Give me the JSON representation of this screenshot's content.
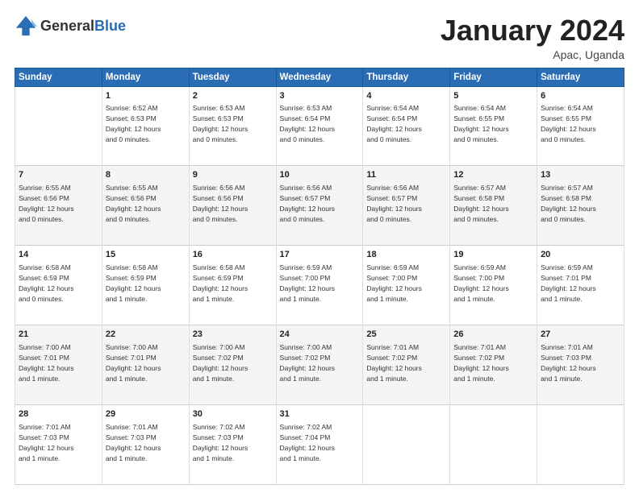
{
  "header": {
    "logo_general": "General",
    "logo_blue": "Blue",
    "title": "January 2024",
    "location": "Apac, Uganda"
  },
  "weekdays": [
    "Sunday",
    "Monday",
    "Tuesday",
    "Wednesday",
    "Thursday",
    "Friday",
    "Saturday"
  ],
  "weeks": [
    [
      {
        "day": "",
        "info": ""
      },
      {
        "day": "1",
        "info": "Sunrise: 6:52 AM\nSunset: 6:53 PM\nDaylight: 12 hours\nand 0 minutes."
      },
      {
        "day": "2",
        "info": "Sunrise: 6:53 AM\nSunset: 6:53 PM\nDaylight: 12 hours\nand 0 minutes."
      },
      {
        "day": "3",
        "info": "Sunrise: 6:53 AM\nSunset: 6:54 PM\nDaylight: 12 hours\nand 0 minutes."
      },
      {
        "day": "4",
        "info": "Sunrise: 6:54 AM\nSunset: 6:54 PM\nDaylight: 12 hours\nand 0 minutes."
      },
      {
        "day": "5",
        "info": "Sunrise: 6:54 AM\nSunset: 6:55 PM\nDaylight: 12 hours\nand 0 minutes."
      },
      {
        "day": "6",
        "info": "Sunrise: 6:54 AM\nSunset: 6:55 PM\nDaylight: 12 hours\nand 0 minutes."
      }
    ],
    [
      {
        "day": "7",
        "info": "Sunrise: 6:55 AM\nSunset: 6:56 PM\nDaylight: 12 hours\nand 0 minutes."
      },
      {
        "day": "8",
        "info": "Sunrise: 6:55 AM\nSunset: 6:56 PM\nDaylight: 12 hours\nand 0 minutes."
      },
      {
        "day": "9",
        "info": "Sunrise: 6:56 AM\nSunset: 6:56 PM\nDaylight: 12 hours\nand 0 minutes."
      },
      {
        "day": "10",
        "info": "Sunrise: 6:56 AM\nSunset: 6:57 PM\nDaylight: 12 hours\nand 0 minutes."
      },
      {
        "day": "11",
        "info": "Sunrise: 6:56 AM\nSunset: 6:57 PM\nDaylight: 12 hours\nand 0 minutes."
      },
      {
        "day": "12",
        "info": "Sunrise: 6:57 AM\nSunset: 6:58 PM\nDaylight: 12 hours\nand 0 minutes."
      },
      {
        "day": "13",
        "info": "Sunrise: 6:57 AM\nSunset: 6:58 PM\nDaylight: 12 hours\nand 0 minutes."
      }
    ],
    [
      {
        "day": "14",
        "info": "Sunrise: 6:58 AM\nSunset: 6:59 PM\nDaylight: 12 hours\nand 0 minutes."
      },
      {
        "day": "15",
        "info": "Sunrise: 6:58 AM\nSunset: 6:59 PM\nDaylight: 12 hours\nand 1 minute."
      },
      {
        "day": "16",
        "info": "Sunrise: 6:58 AM\nSunset: 6:59 PM\nDaylight: 12 hours\nand 1 minute."
      },
      {
        "day": "17",
        "info": "Sunrise: 6:59 AM\nSunset: 7:00 PM\nDaylight: 12 hours\nand 1 minute."
      },
      {
        "day": "18",
        "info": "Sunrise: 6:59 AM\nSunset: 7:00 PM\nDaylight: 12 hours\nand 1 minute."
      },
      {
        "day": "19",
        "info": "Sunrise: 6:59 AM\nSunset: 7:00 PM\nDaylight: 12 hours\nand 1 minute."
      },
      {
        "day": "20",
        "info": "Sunrise: 6:59 AM\nSunset: 7:01 PM\nDaylight: 12 hours\nand 1 minute."
      }
    ],
    [
      {
        "day": "21",
        "info": "Sunrise: 7:00 AM\nSunset: 7:01 PM\nDaylight: 12 hours\nand 1 minute."
      },
      {
        "day": "22",
        "info": "Sunrise: 7:00 AM\nSunset: 7:01 PM\nDaylight: 12 hours\nand 1 minute."
      },
      {
        "day": "23",
        "info": "Sunrise: 7:00 AM\nSunset: 7:02 PM\nDaylight: 12 hours\nand 1 minute."
      },
      {
        "day": "24",
        "info": "Sunrise: 7:00 AM\nSunset: 7:02 PM\nDaylight: 12 hours\nand 1 minute."
      },
      {
        "day": "25",
        "info": "Sunrise: 7:01 AM\nSunset: 7:02 PM\nDaylight: 12 hours\nand 1 minute."
      },
      {
        "day": "26",
        "info": "Sunrise: 7:01 AM\nSunset: 7:02 PM\nDaylight: 12 hours\nand 1 minute."
      },
      {
        "day": "27",
        "info": "Sunrise: 7:01 AM\nSunset: 7:03 PM\nDaylight: 12 hours\nand 1 minute."
      }
    ],
    [
      {
        "day": "28",
        "info": "Sunrise: 7:01 AM\nSunset: 7:03 PM\nDaylight: 12 hours\nand 1 minute."
      },
      {
        "day": "29",
        "info": "Sunrise: 7:01 AM\nSunset: 7:03 PM\nDaylight: 12 hours\nand 1 minute."
      },
      {
        "day": "30",
        "info": "Sunrise: 7:02 AM\nSunset: 7:03 PM\nDaylight: 12 hours\nand 1 minute."
      },
      {
        "day": "31",
        "info": "Sunrise: 7:02 AM\nSunset: 7:04 PM\nDaylight: 12 hours\nand 1 minute."
      },
      {
        "day": "",
        "info": ""
      },
      {
        "day": "",
        "info": ""
      },
      {
        "day": "",
        "info": ""
      }
    ]
  ]
}
